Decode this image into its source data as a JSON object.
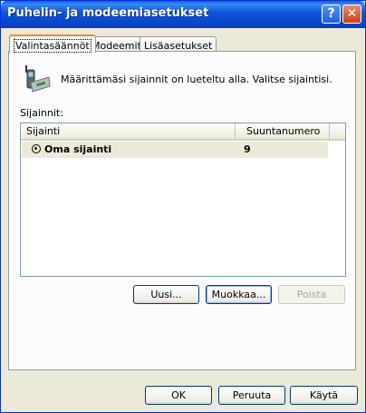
{
  "window": {
    "title": "Puhelin- ja modeemiasetukset"
  },
  "titlebar_buttons": {
    "help": "?",
    "close": "✕"
  },
  "tabs": [
    {
      "label": "Valintasäännöt"
    },
    {
      "label": "Modeemit"
    },
    {
      "label": "Lisäasetukset"
    }
  ],
  "dialing": {
    "description": "Määrittämäsi sijainnit on lueteltu alla. Valitse sijaintisi.",
    "locations_label": "Sijainnit:",
    "columns": {
      "location": "Sijainti",
      "area_code": "Suuntanumero"
    },
    "rows": [
      {
        "name": "Oma sijainti",
        "area_code": "9"
      }
    ],
    "buttons": {
      "new": "Uusi...",
      "edit": "Muokkaa...",
      "delete": "Poista"
    }
  },
  "footer": {
    "ok": "OK",
    "cancel": "Peruuta",
    "apply": "Käytä"
  }
}
